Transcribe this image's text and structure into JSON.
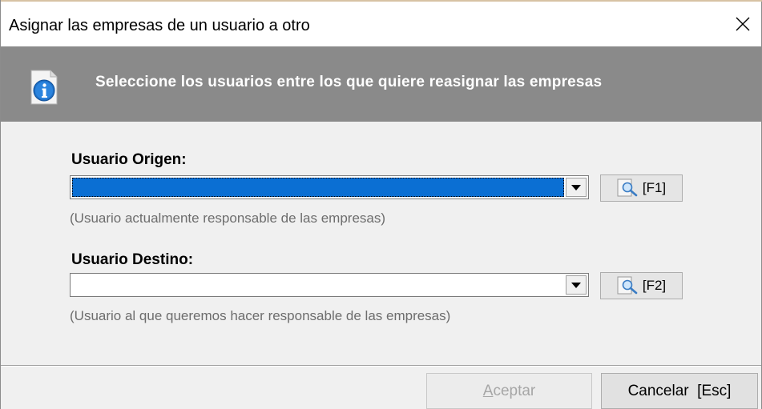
{
  "window": {
    "title": "Asignar las empresas de un usuario a otro",
    "close_glyph": "✕"
  },
  "banner": {
    "icon": "info-icon",
    "text": "Seleccione los usuarios entre los que quiere reasignar las empresas",
    "background": "#8a8a8a"
  },
  "origin": {
    "label": "Usuario Origen:",
    "value": "",
    "selected_color": "#0b6fd3",
    "search_label": "[F1]",
    "hint": "(Usuario actualmente responsable de las empresas)"
  },
  "destination": {
    "label": "Usuario Destino:",
    "value": "",
    "search_label": "[F2]",
    "hint": "(Usuario al que queremos hacer responsable de las empresas)"
  },
  "footer": {
    "accept_first": "A",
    "accept_rest": "ceptar",
    "cancel_label": "Cancelar  [Esc]"
  }
}
